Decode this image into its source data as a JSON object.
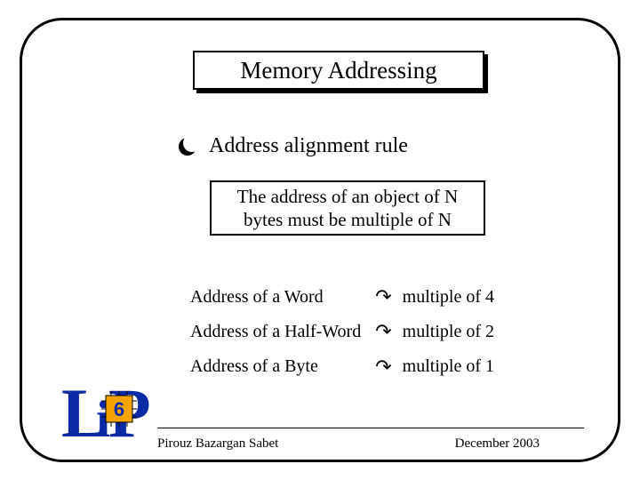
{
  "title": "Memory Addressing",
  "bullet": "Address alignment rule",
  "rule_line1": "The address of an object of N",
  "rule_line2": "bytes must be multiple of N",
  "rows": [
    {
      "left": "Address of a Word",
      "right": "multiple of 4"
    },
    {
      "left": "Address of a Half-Word",
      "right": "multiple of 2"
    },
    {
      "left": "Address of a Byte",
      "right": "multiple of 1"
    }
  ],
  "footer": {
    "author": "Pirouz Bazargan Sabet",
    "date": "December 2003"
  },
  "logo": {
    "letters": {
      "L": "L",
      "I": "i",
      "P": "P"
    },
    "chip": "6"
  },
  "glyphs": {
    "arrow": "↷"
  }
}
